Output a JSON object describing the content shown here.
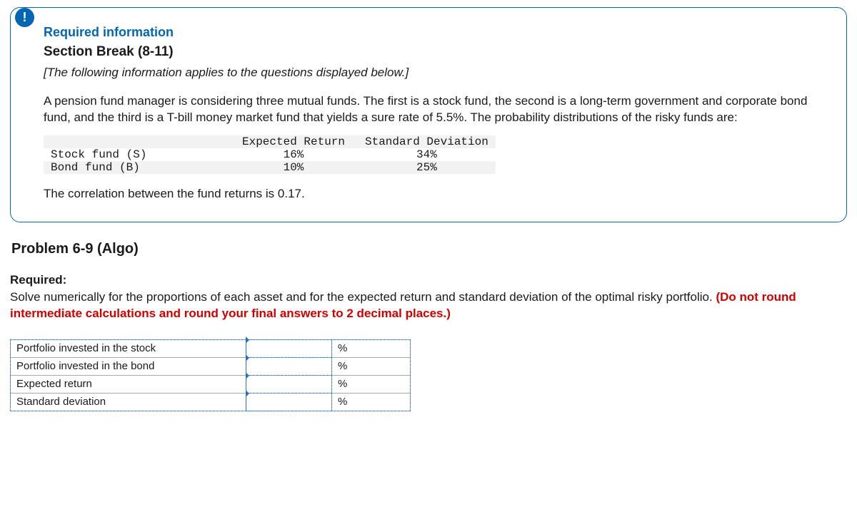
{
  "header": {
    "badge_char": "!",
    "required_info": "Required information",
    "section_break": "Section Break (8-11)",
    "intro": "[The following information applies to the questions displayed below.]",
    "para": "A pension fund manager is considering three mutual funds. The first is a stock fund, the second is a long-term government and corporate bond fund, and the third is a T-bill money market fund that yields a sure rate of 5.5%. The probability distributions of the risky funds are:"
  },
  "data_table": {
    "col1": "Expected Return",
    "col2": "Standard Deviation",
    "rows": [
      {
        "name": "Stock fund (S)",
        "er": "16%",
        "sd": "34%"
      },
      {
        "name": "Bond fund (B)",
        "er": "10%",
        "sd": "25%"
      }
    ],
    "corr_text": "The correlation between the fund returns is 0.17."
  },
  "problem": {
    "title": "Problem 6-9 (Algo)",
    "required_label": "Required:",
    "text_plain": "Solve numerically for the proportions of each asset and for the expected return and standard deviation of the optimal risky portfolio. ",
    "red": "(Do not round intermediate calculations and round your final answers to 2 decimal places.)"
  },
  "answers": {
    "rows": [
      {
        "label": "Portfolio invested in the stock",
        "unit": "%"
      },
      {
        "label": "Portfolio invested in the bond",
        "unit": "%"
      },
      {
        "label": "Expected return",
        "unit": "%"
      },
      {
        "label": "Standard deviation",
        "unit": "%"
      }
    ]
  }
}
